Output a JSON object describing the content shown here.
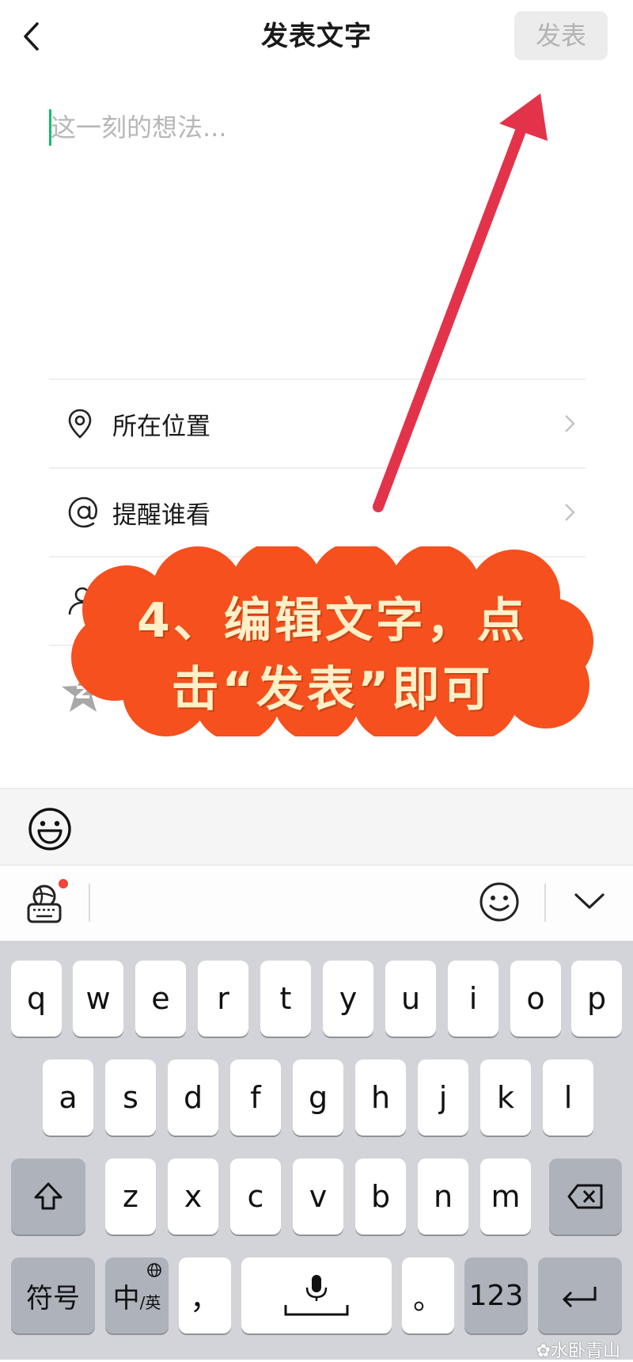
{
  "header": {
    "title": "发表文字",
    "publish_label": "发表"
  },
  "composer": {
    "placeholder": "这一刻的想法...",
    "value": ""
  },
  "options": [
    {
      "label": "所在位置",
      "icon": "location-pin-icon"
    },
    {
      "label": "提醒谁看",
      "icon": "at-sign-icon"
    }
  ],
  "annotation": {
    "line1": "4、编辑文字，点",
    "line2": "击“发表”即可",
    "color": "#f5501e",
    "arrow_color": "#e3334a"
  },
  "emoji_strip": {
    "icon": "smiley-icon"
  },
  "keyboard_toolbar": {
    "settings_icon": "keyboard-settings-icon",
    "emoji_icon": "emoji-icon",
    "hide_icon": "chevron-down-icon"
  },
  "keyboard": {
    "row1": [
      "q",
      "w",
      "e",
      "r",
      "t",
      "y",
      "u",
      "i",
      "o",
      "p"
    ],
    "row2": [
      "a",
      "s",
      "d",
      "f",
      "g",
      "h",
      "j",
      "k",
      "l"
    ],
    "row3": [
      "z",
      "x",
      "c",
      "v",
      "b",
      "n",
      "m"
    ],
    "symbols_label": "符号",
    "lang_main": "中",
    "lang_sub": "/英",
    "comma": "，",
    "period": "。",
    "numbers_label": "123"
  },
  "watermark": "水卧青山"
}
